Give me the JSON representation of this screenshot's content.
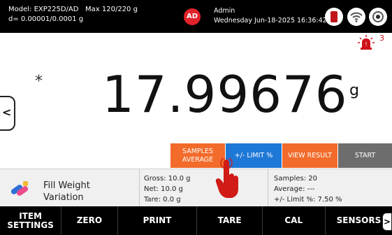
{
  "header": {
    "model_line": "Model: EXP225D/AD   Max 120/220 g",
    "division_line": "d= 0.00001/0.0001 g",
    "avatar_initials": "AD",
    "user_name": "Admin",
    "datetime": "Wednesday Jun-18-2025 16:36:42",
    "icons": [
      "usb-icon",
      "wifi-icon",
      "camera-icon"
    ]
  },
  "alerts": {
    "count": "3",
    "icon": "siren-icon"
  },
  "display": {
    "stability_marker": "*",
    "weight": "17.99676",
    "unit": "g"
  },
  "actions": {
    "samples_average": "SAMPLES AVERAGE",
    "limit": "+/- LIMIT %",
    "view_result": "VIEW RESULT",
    "start": "START"
  },
  "application": {
    "name_line1": "Fill Weight",
    "name_line2": "Variation",
    "icon": "fill-weight-icon"
  },
  "readings": {
    "gross": "Gross: 10.0 g",
    "net": "Net: 10.0 g",
    "tare": "Tare: 0.0  g",
    "samples": "Samples: 20",
    "average": "Average: ---",
    "limit": "+/- Limit %: 7.50 %"
  },
  "nav": {
    "item_settings": "ITEM SETTINGS",
    "zero": "ZERO",
    "print": "PRINT",
    "tare": "TARE",
    "cal": "CAL",
    "sensors": "SENSORS"
  },
  "colors": {
    "orange": "#f26b2a",
    "blue": "#1e78d7",
    "gray": "#6d6d6d",
    "red": "#e2222a"
  }
}
